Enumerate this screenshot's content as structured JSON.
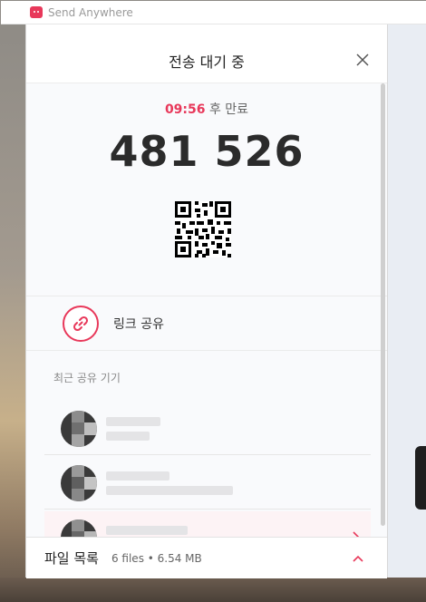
{
  "app": {
    "title": "Send Anywhere"
  },
  "dialog": {
    "title": "전송 대기 중",
    "timer": {
      "time": "09:56",
      "suffix": "후 만료"
    },
    "code": "481 526"
  },
  "link_share": {
    "label": "링크 공유"
  },
  "recent": {
    "label": "최근 공유 기기"
  },
  "footer": {
    "title": "파일 목록",
    "info": "6 files • 6.54 MB"
  },
  "colors": {
    "accent": "#e8385a"
  },
  "icons": {
    "close": "close-icon",
    "link": "link-icon",
    "chevron": "chevron-right-icon",
    "up": "chevron-up-icon"
  }
}
